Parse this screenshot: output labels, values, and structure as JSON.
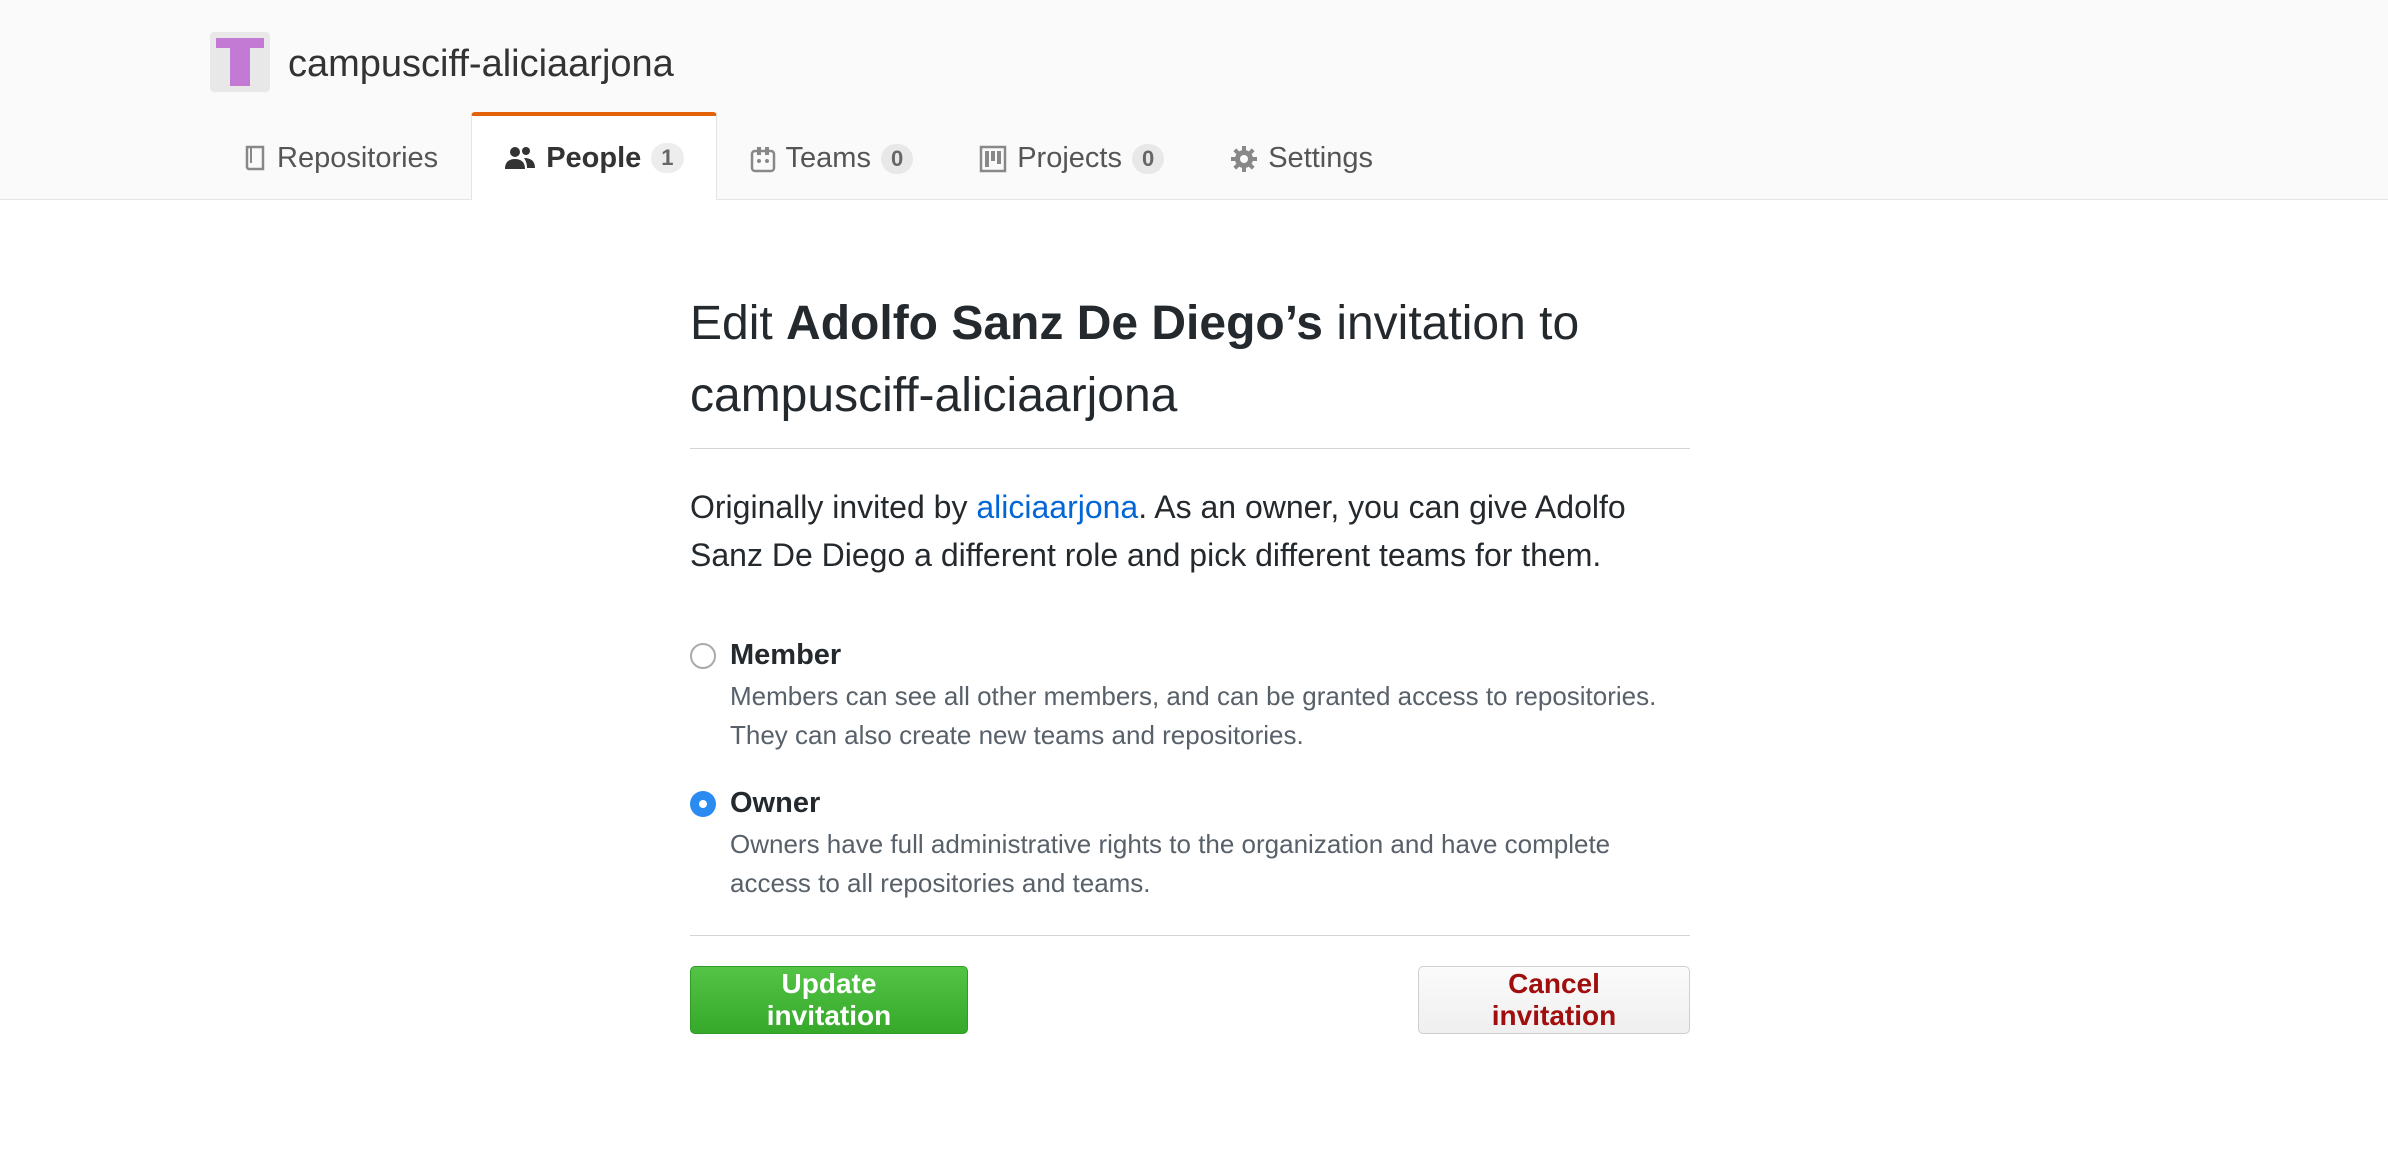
{
  "org": {
    "name": "campusciff-aliciaarjona",
    "avatar_color": "#c27ad4"
  },
  "tabs": [
    {
      "label": "Repositories",
      "icon": "repo-icon",
      "count": null,
      "selected": false
    },
    {
      "label": "People",
      "icon": "people-icon",
      "count": "1",
      "selected": true
    },
    {
      "label": "Teams",
      "icon": "teams-icon",
      "count": "0",
      "selected": false
    },
    {
      "label": "Projects",
      "icon": "projects-icon",
      "count": "0",
      "selected": false
    },
    {
      "label": "Settings",
      "icon": "gear-icon",
      "count": null,
      "selected": false
    }
  ],
  "heading": {
    "prefix": "Edit ",
    "name": "Adolfo Sanz De Diego’s",
    "suffix": " invitation to campusciff-aliciaarjona"
  },
  "intro": {
    "prefix": "Originally invited by ",
    "inviter": "aliciaarjona",
    "suffix": ". As an owner, you can give Adolfo Sanz De Diego a different role and pick different teams for them."
  },
  "roles": [
    {
      "title": "Member",
      "description": "Members can see all other members, and can be granted access to repositories. They can also create new teams and repositories.",
      "checked": false
    },
    {
      "title": "Owner",
      "description": "Owners have full administrative rights to the organization and have complete access to all repositories and teams.",
      "checked": true
    }
  ],
  "actions": {
    "update_label": "Update invitation",
    "cancel_label": "Cancel invitation"
  },
  "colors": {
    "accent_tab": "#e36209",
    "link": "#0366d6",
    "primary_button": "#36a82a",
    "danger_text": "#a10e0e",
    "radio_checked": "#2a8cf0"
  }
}
